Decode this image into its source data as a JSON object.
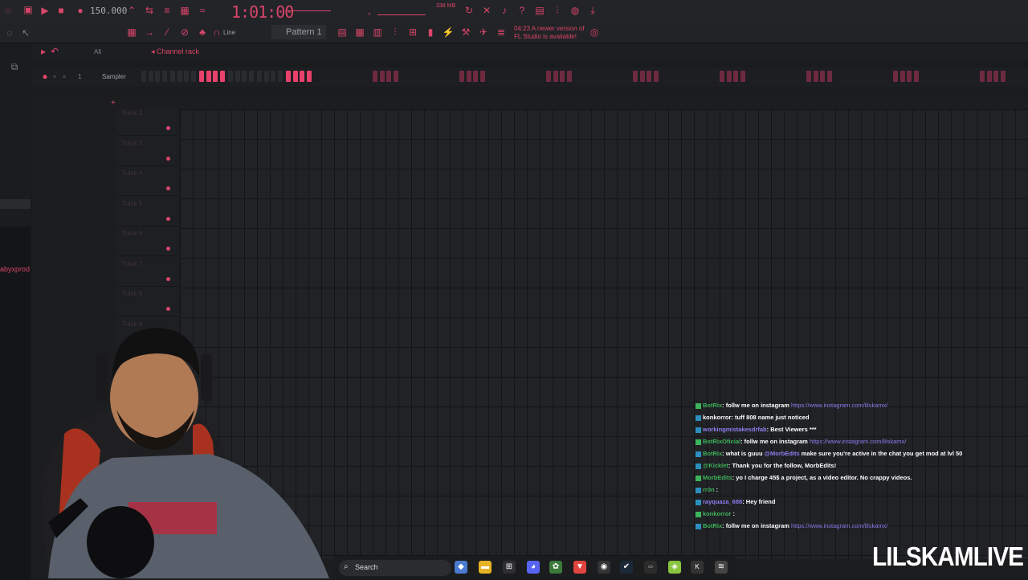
{
  "transport": {
    "tempo": "150.000",
    "time": "1:01:00",
    "memory": "338 MB"
  },
  "toolbar": {
    "snap_label": "Line",
    "pattern": "Pattern 1",
    "update_notice_line1": "04:23 A newer version of",
    "update_notice_line2": "FL Studio is available!"
  },
  "channel_rack": {
    "filter": "All",
    "title": "Channel rack",
    "channel_number": "1",
    "channel_name": "Sampler",
    "steps": [
      0,
      0,
      0,
      0,
      0,
      0,
      0,
      0,
      1,
      1,
      1,
      1,
      0,
      0,
      0,
      0,
      0,
      0,
      0,
      0,
      1,
      1,
      1,
      1
    ]
  },
  "left_panel": {
    "tag": "abyxprod"
  },
  "playlist": {
    "tracks": [
      "Track 2",
      "Track 3",
      "Track 4",
      "Track 5",
      "Track 6",
      "Track 7",
      "Track 8",
      "Track 9"
    ]
  },
  "chat": {
    "messages": [
      {
        "user": "BotRix",
        "user_color": "#3db35b",
        "text": ": follw me on instagram ",
        "link": "https://www.instagram.com/lilskamx/"
      },
      {
        "user": "konkorror",
        "user_color": "#ffffff",
        "text": ": tuff 808 name just noticed",
        "link": ""
      },
      {
        "user": "workingmistakesdrfab",
        "user_color": "#8b7ef0",
        "text": ": Best Viewers ***",
        "link": ""
      },
      {
        "user": "BotRixOficial",
        "user_color": "#3db35b",
        "text": ": follw me on instagram ",
        "link": "https://www.instagram.com/lilskamx/"
      },
      {
        "user": "BotRix",
        "user_color": "#3db35b",
        "text": ": what is guuu ",
        "mention": "@MorbEdits",
        "text2": " make sure you're active in the chat you get mod at lvl 50",
        "link": ""
      },
      {
        "user": "@Kicklet",
        "user_color": "#3db35b",
        "text": ": Thank you for the follow, MorbEdits!",
        "link": ""
      },
      {
        "user": "MorbEdits",
        "user_color": "#3db35b",
        "text": ": yo I charge 45$ a project, as a video editor. No crappy videos.",
        "link": ""
      },
      {
        "user": "rr0n",
        "user_color": "#3db35b",
        "text": " :",
        "link": ""
      },
      {
        "user": "rayquaza_688",
        "user_color": "#8b7ef0",
        "text": ": Hey friend",
        "link": ""
      },
      {
        "user": "konkorror",
        "user_color": "#3db35b",
        "text": " :",
        "link": ""
      },
      {
        "user": "BotRix",
        "user_color": "#3db35b",
        "text": ": follw me on instagram ",
        "link": "https://www.instagram.com/lilskamx/"
      }
    ]
  },
  "taskbar": {
    "search_label": "Search"
  },
  "watermark": "LILSKAMLIVE"
}
